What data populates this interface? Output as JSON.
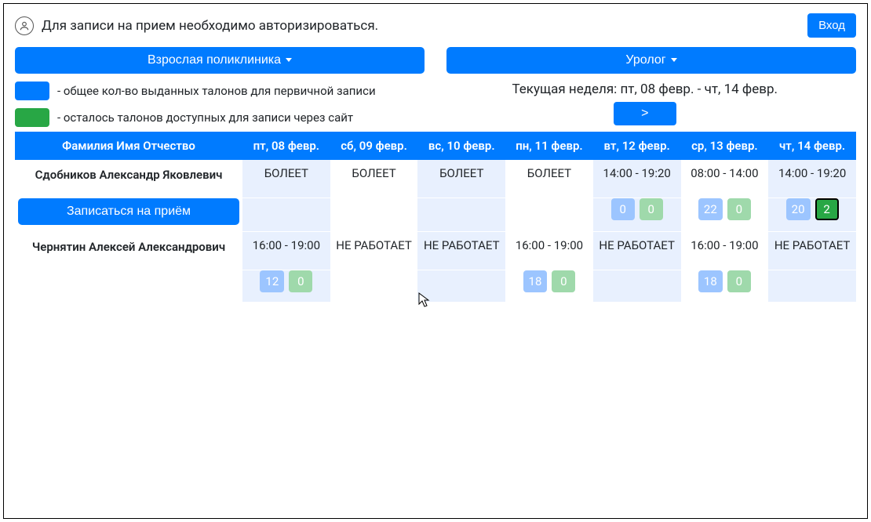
{
  "notice": "Для записи на прием необходимо авторизироваться.",
  "login": "Вход",
  "clinic_dropdown": "Взрослая поликлиника",
  "specialty_dropdown": "Уролог",
  "legend": {
    "total": "- общее кол-во выданных талонов для первичной записи",
    "available": "- осталось талонов доступных для записи через сайт"
  },
  "week_label": "Текущая неделя: пт, 08 февр. - чт, 14 февр.",
  "next_btn": ">",
  "headers": {
    "name": "Фамилия Имя Отчество",
    "days": [
      "пт, 08 февр.",
      "сб, 09 февр.",
      "вс, 10 февр.",
      "пн, 11 февр.",
      "вт, 12 февр.",
      "ср, 13 февр.",
      "чт, 14 февр."
    ]
  },
  "book_label": "Записаться на приём",
  "doctors": [
    {
      "name": "Сдобников Александр Яковлевич",
      "days": [
        {
          "text": "БОЛЕЕТ"
        },
        {
          "text": "БОЛЕЕТ"
        },
        {
          "text": "БОЛЕЕТ"
        },
        {
          "text": "БОЛЕЕТ"
        },
        {
          "text": "14:00 - 19:20",
          "total": "0",
          "avail": "0"
        },
        {
          "text": "08:00 - 14:00",
          "total": "22",
          "avail": "0"
        },
        {
          "text": "14:00 - 19:20",
          "total": "20",
          "avail": "2",
          "active": true
        }
      ]
    },
    {
      "name": "Чернятин Алексей Александрович",
      "days": [
        {
          "text": "16:00 - 19:00",
          "total": "12",
          "avail": "0"
        },
        {
          "text": "НЕ РАБОТАЕТ"
        },
        {
          "text": "НЕ РАБОТАЕТ"
        },
        {
          "text": "16:00 - 19:00",
          "total": "18",
          "avail": "0"
        },
        {
          "text": "НЕ РАБОТАЕТ"
        },
        {
          "text": "16:00 - 19:00",
          "total": "18",
          "avail": "0"
        },
        {
          "text": "НЕ РАБОТАЕТ"
        }
      ]
    }
  ]
}
